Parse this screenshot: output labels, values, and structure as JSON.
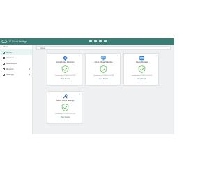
{
  "app": {
    "brand": "IT Cloud Settings",
    "header_icons": [
      "settings-icon",
      "help-icon",
      "notifications-icon",
      "user-icon"
    ]
  },
  "sidebar": {
    "title": "Menu",
    "collapse_glyph": "‹",
    "items": [
      {
        "label": "Home",
        "icon": "home-icon",
        "active": true
      },
      {
        "label": "Account",
        "icon": "account-icon"
      },
      {
        "label": "Dashboard",
        "icon": "dashboard-icon"
      },
      {
        "label": "Reports",
        "icon": "reports-icon",
        "expandable": true
      },
      {
        "label": "Settings",
        "icon": "settings-icon",
        "expandable": true
      }
    ]
  },
  "main": {
    "breadcrumb": "Home",
    "cards": [
      {
        "title": "Azure Active Directory",
        "status": "ok",
        "description": "Last backup on 1/24/23 at 2:00 PM",
        "link": "View Details"
      },
      {
        "title": "Azure Virtual Machine",
        "status": "ok",
        "description": "Last backup on 1/24/23 at 2:00 PM",
        "link": "View Details"
      },
      {
        "title": "Azure Storage",
        "status": "ok",
        "description": "Last backup on 1/24/23 at 2:00 PM",
        "link": "View Details"
      },
      {
        "title": "Admin Portal Settings",
        "status": "ok",
        "description": "Last backup on 1/24/23 at 2:00 PM",
        "link": "View Details"
      }
    ]
  },
  "colors": {
    "header": "#3a7d74",
    "shield": "#5cb85c",
    "background": "#eef0f1"
  }
}
